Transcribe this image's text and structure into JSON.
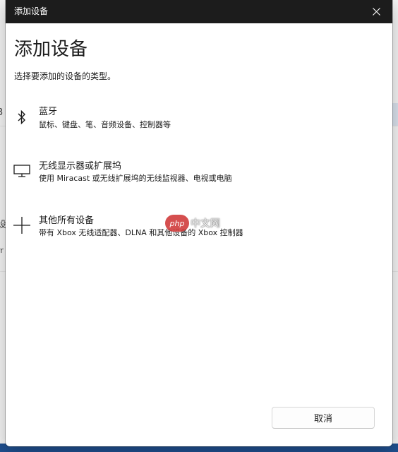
{
  "dialog": {
    "title": "添加设备",
    "heading": "添加设备",
    "subtitle": "选择要添加的设备的类型。",
    "options": [
      {
        "icon": "bluetooth-icon",
        "title": "蓝牙",
        "description": "鼠标、键盘、笔、音频设备、控制器等"
      },
      {
        "icon": "monitor-icon",
        "title": "无线显示器或扩展坞",
        "description": "使用 Miracast 或无线扩展坞的无线监视器、电视或电脑"
      },
      {
        "icon": "plus-icon",
        "title": "其他所有设备",
        "description": "带有 Xbox 无线适配器、DLNA 和其他设备的 Xbox 控制器"
      }
    ],
    "cancel_label": "取消"
  },
  "background": {
    "partial_chars": [
      "3",
      "设",
      "rr"
    ]
  },
  "watermark": {
    "badge": "php",
    "text": "中文网"
  },
  "colors": {
    "titlebar": "#1c1c1c",
    "dialog_bg": "#ffffff",
    "text": "#1b1b1b"
  }
}
